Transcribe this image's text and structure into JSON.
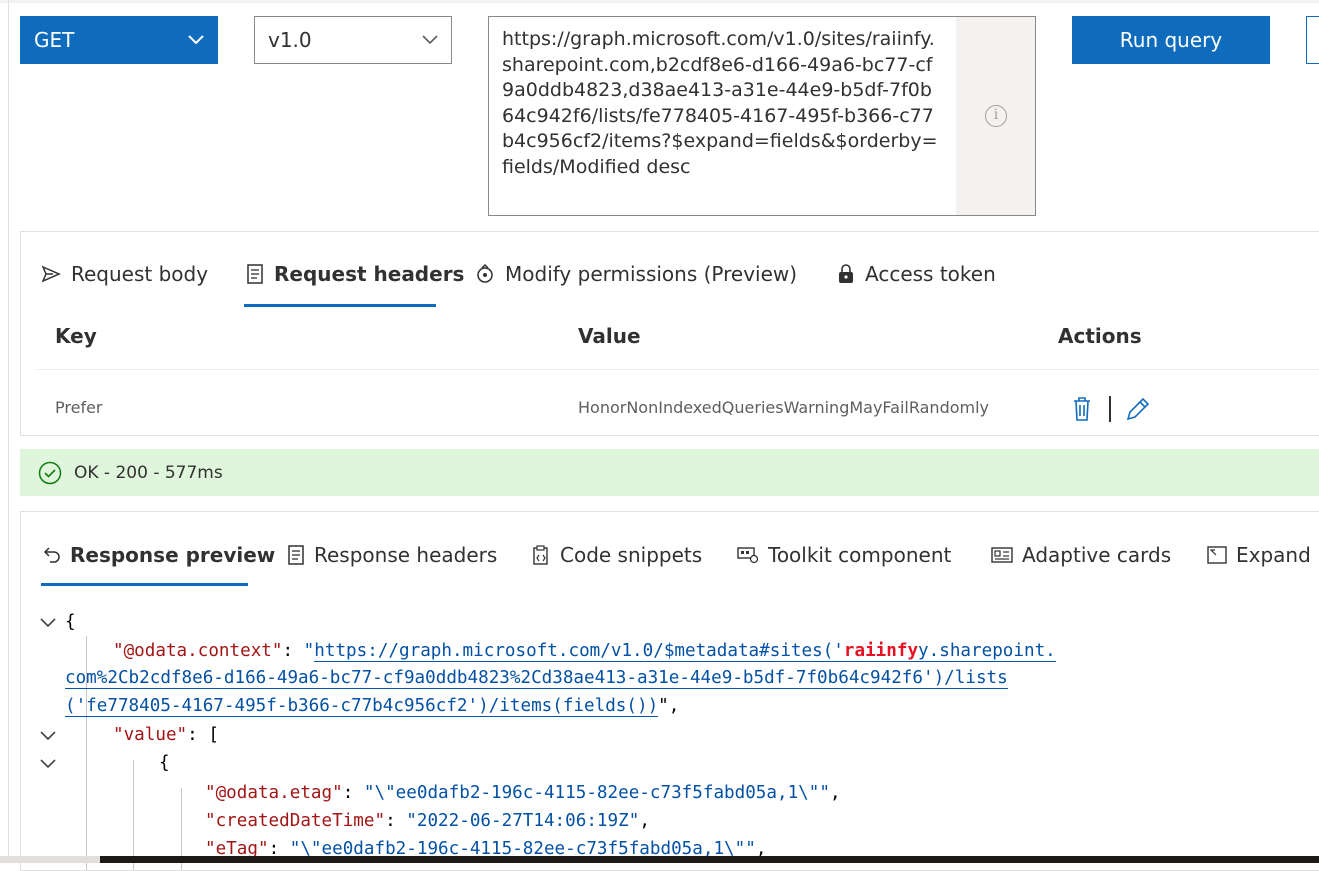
{
  "request": {
    "method": "GET",
    "version": "v1.0",
    "url": "https://graph.microsoft.com/v1.0/sites/raiinfy.sharepoint.com,b2cdf8e6-d166-49a6-bc77-cf9a0ddb4823,d38ae413-a31e-44e9-b5df-7f0b64c942f6/lists/fe778405-4167-495f-b366-c77b4c956cf2/items?$expand=fields&$orderby=fields/Modified desc",
    "run_label": "Run query"
  },
  "request_tabs": [
    {
      "label": "Request body",
      "icon": "send-icon"
    },
    {
      "label": "Request headers",
      "icon": "document-header-icon"
    },
    {
      "label": "Modify permissions (Preview)",
      "icon": "permissions-icon"
    },
    {
      "label": "Access token",
      "icon": "lock-icon"
    }
  ],
  "headers_table": {
    "columns": [
      "Key",
      "Value",
      "Actions"
    ],
    "rows": [
      {
        "key": "Prefer",
        "value": "HonorNonIndexedQueriesWarningMayFailRandomly"
      }
    ]
  },
  "status": {
    "text": "OK - 200 - 577ms",
    "color": "#dff6dd"
  },
  "response_tabs": [
    {
      "label": "Response preview",
      "icon": "undo-arrow-icon"
    },
    {
      "label": "Response headers",
      "icon": "document-header-icon"
    },
    {
      "label": "Code snippets",
      "icon": "code-clipboard-icon"
    },
    {
      "label": "Toolkit component",
      "icon": "toolkit-icon"
    },
    {
      "label": "Adaptive cards",
      "icon": "card-icon"
    },
    {
      "label": "Expand",
      "icon": "expand-icon"
    }
  ],
  "response": {
    "open_brace": "{",
    "context_key": "\"@odata.context\"",
    "context_line1_pre": "\"",
    "context_line1_link": "https://graph.microsoft.com/v1.0/$metadata#sites('",
    "context_redacted": "raiinfy",
    "context_line1_link2": "y.sharepoint.",
    "context_line2": "com%2Cb2cdf8e6-d166-49a6-bc77-cf9a0ddb4823%2Cd38ae413-a31e-44e9-b5df-7f0b64c942f6')/lists",
    "context_line3": "('fe778405-4167-495f-b366-c77b4c956cf2')/items(fields())",
    "context_tail": "\",",
    "value_key": "\"value\"",
    "value_open": "[",
    "item_open": "{",
    "etag_key": "\"@odata.etag\"",
    "etag_value": "\"\\\"ee0dafb2-196c-4115-82ee-c73f5fabd05a,1\\\"\"",
    "created_key": "\"createdDateTime\"",
    "created_value": "\"2022-06-27T14:06:19Z\"",
    "etag2_key": "\"eTag\"",
    "etag2_value": "\"\\\"ee0dafb2-196c-4115-82ee-c73f5fabd05a,1\\\"\""
  },
  "colors": {
    "accent": "#0f6cbd",
    "json_key": "#a31515",
    "json_string": "#0451a5",
    "success_bg": "#dff6dd"
  }
}
